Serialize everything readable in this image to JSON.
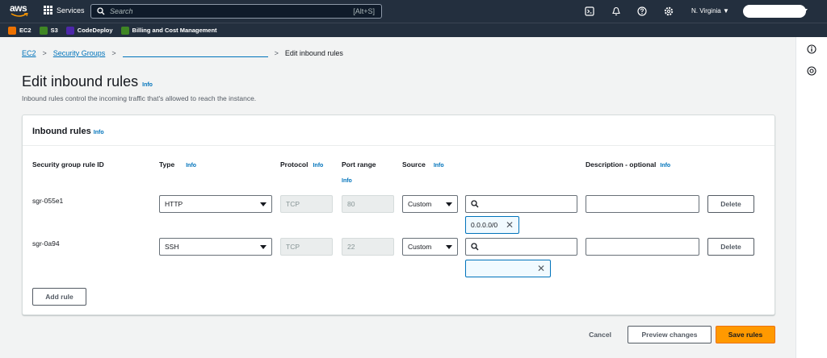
{
  "topbar": {
    "logo_text": "aws",
    "services_label": "Services",
    "search_placeholder": "Search",
    "search_shortcut": "[Alt+S]",
    "region": "N. Virginia",
    "icons": [
      "cloudshell-icon",
      "bell-icon",
      "help-icon",
      "gear-icon"
    ]
  },
  "favorites": [
    {
      "label": "EC2",
      "color": "#ed7100"
    },
    {
      "label": "S3",
      "color": "#3f8624"
    },
    {
      "label": "CodeDeploy",
      "color": "#4d27aa"
    },
    {
      "label": "Billing and Cost Management",
      "color": "#3f8624"
    }
  ],
  "breadcrumb": {
    "items": [
      "EC2",
      "Security Groups"
    ],
    "current": "Edit inbound rules"
  },
  "page": {
    "title": "Edit inbound rules",
    "title_info": "Info",
    "subtitle": "Inbound rules control the incoming traffic that's allowed to reach the instance."
  },
  "panel": {
    "title": "Inbound rules",
    "title_info": "Info",
    "columns": {
      "rule_id": "Security group rule ID",
      "type": "Type",
      "protocol": "Protocol",
      "port_range": "Port range",
      "source": "Source",
      "description": "Description - optional",
      "info": "Info"
    },
    "rows": [
      {
        "rule_id": "sgr-055e1",
        "type": "HTTP",
        "protocol": "TCP",
        "port": "80",
        "source": "Custom",
        "token": "0.0.0.0/0",
        "delete": "Delete"
      },
      {
        "rule_id": "sgr-0a94",
        "type": "SSH",
        "protocol": "TCP",
        "port": "22",
        "source": "Custom",
        "token": "",
        "delete": "Delete"
      }
    ],
    "add_rule": "Add rule"
  },
  "footer": {
    "cancel": "Cancel",
    "preview": "Preview changes",
    "save": "Save rules"
  },
  "colors": {
    "accent": "#ff9900",
    "link": "#0073bb",
    "nav": "#232f3e"
  }
}
